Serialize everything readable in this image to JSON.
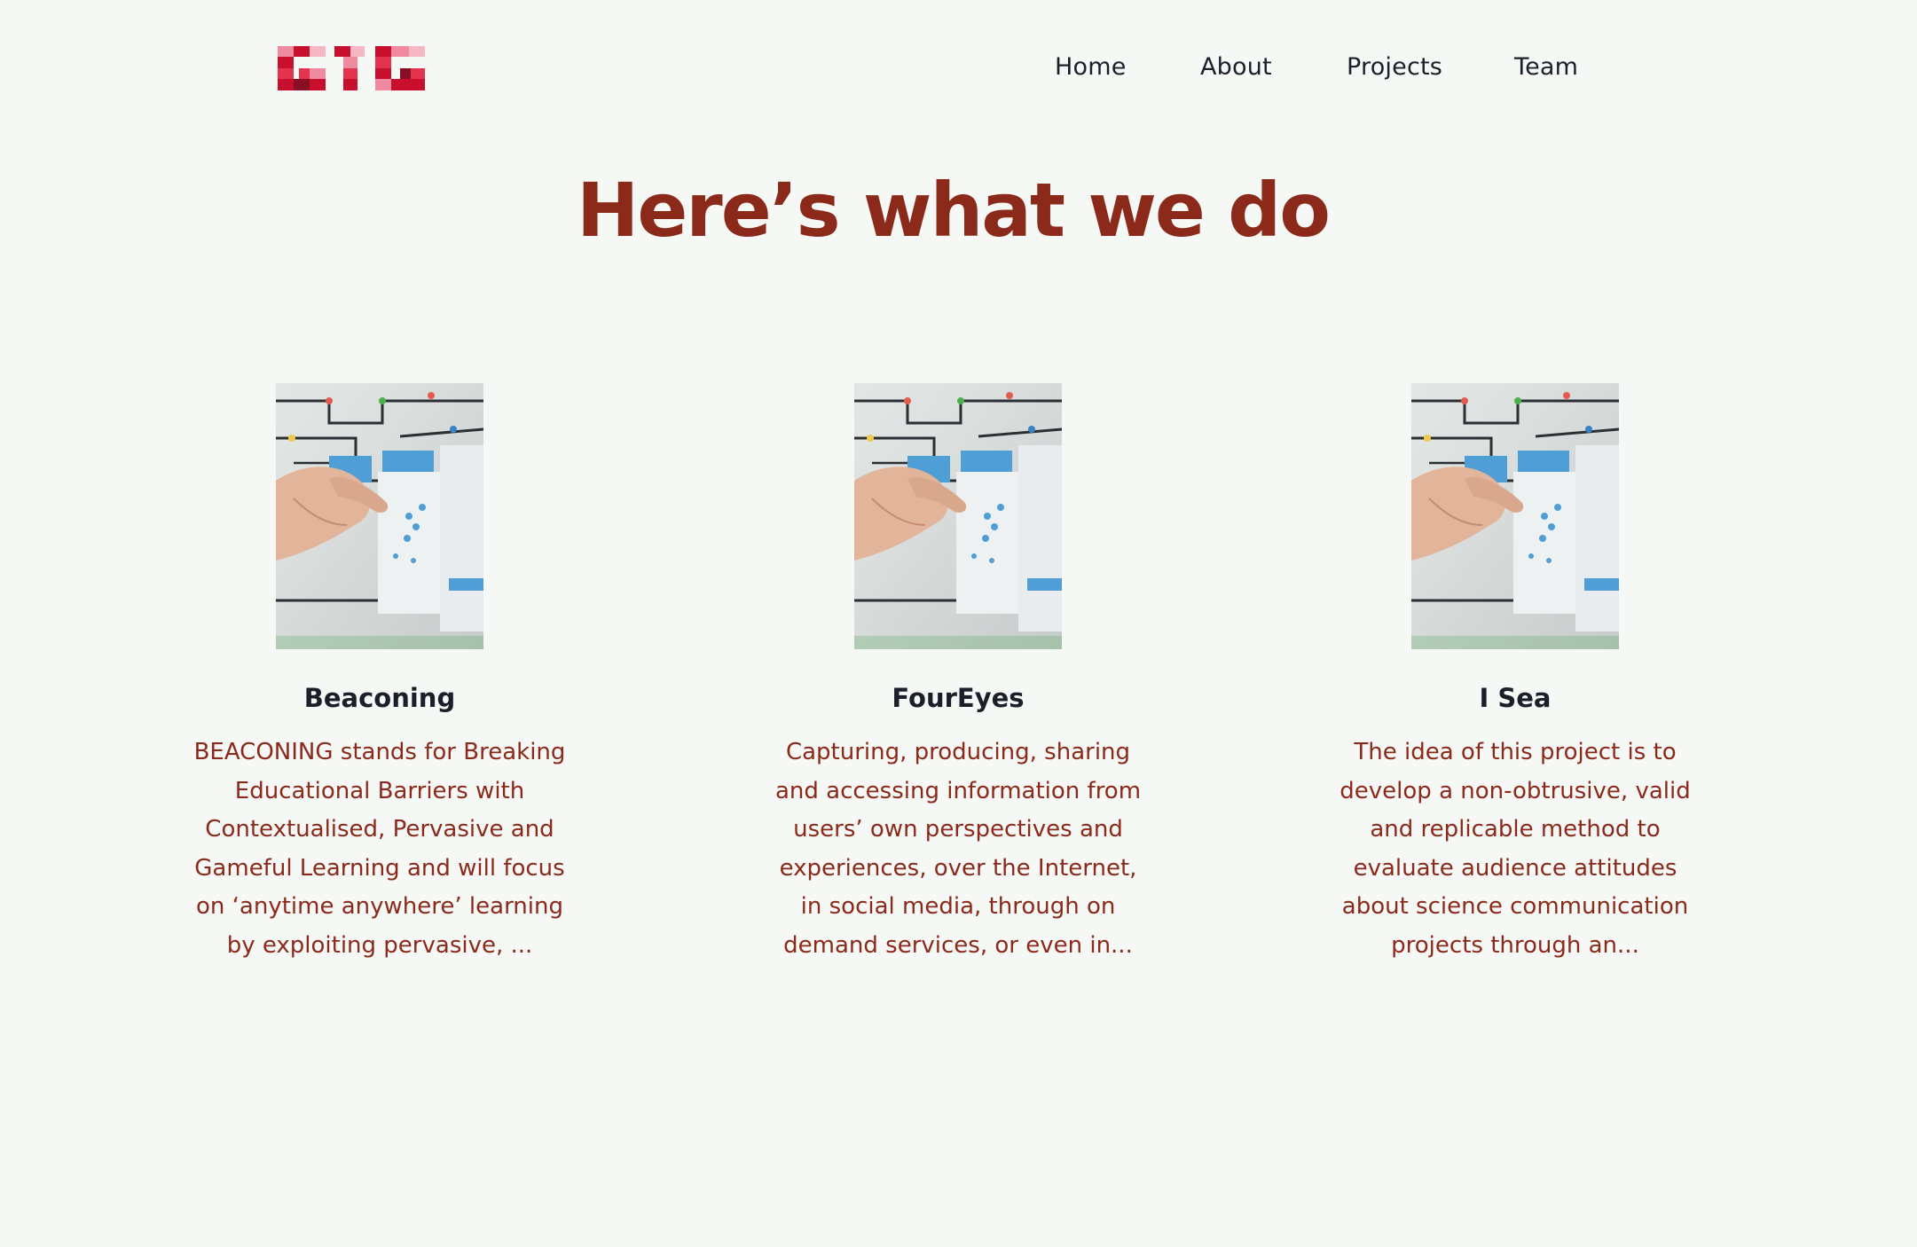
{
  "brand": {
    "logo_text": "GIG",
    "colors": {
      "primary": "#c8102e",
      "secondary": "#f08aa0",
      "dark": "#8a0e24"
    }
  },
  "nav": {
    "items": [
      {
        "label": "Home"
      },
      {
        "label": "About"
      },
      {
        "label": "Projects"
      },
      {
        "label": "Team"
      }
    ]
  },
  "main": {
    "headline": "Here’s what we do",
    "projects": [
      {
        "title": "Beaconing",
        "description": "BEACONING stands for Breaking Educational Barriers with Contextualised, Pervasive and Gameful Learning and will focus on ‘anytime anywhere’ learning by exploiting pervasive, ..."
      },
      {
        "title": "FourEyes",
        "description": "Capturing, producing, sharing and accessing information from users’ own perspectives and experiences, over the Internet, in social media, through on demand services, or even in..."
      },
      {
        "title": "I Sea",
        "description": "The idea of this project is to develop a non-obtrusive, valid and replicable method to evaluate audience attitudes about science communication projects through an..."
      }
    ]
  },
  "theme": {
    "background": "#f6f8f5",
    "heading_color": "#8b2a1a",
    "text_color": "#1b1f2a"
  }
}
